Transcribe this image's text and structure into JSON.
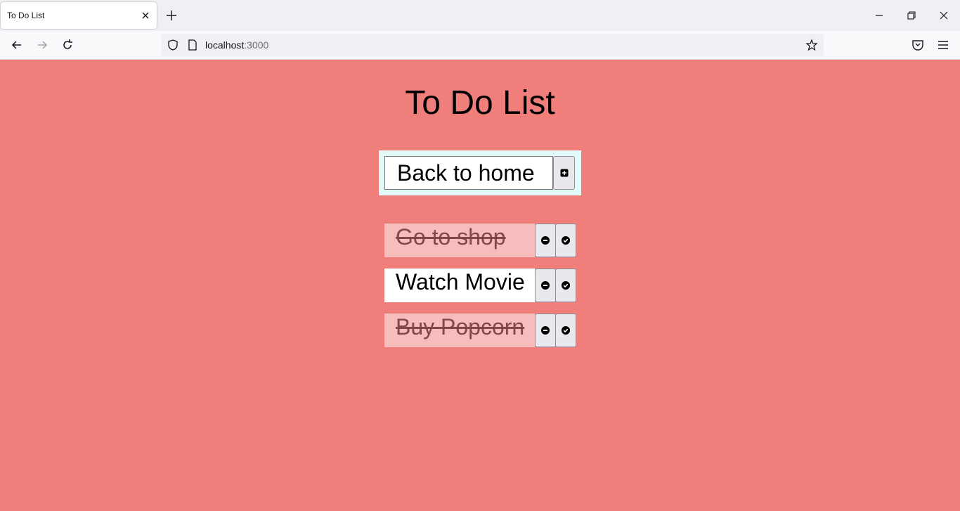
{
  "browser": {
    "tab_title": "To Do List",
    "url_host": "localhost",
    "url_port": ":3000"
  },
  "app": {
    "title": "To Do List",
    "input_value": "Back to home"
  },
  "items": [
    {
      "text": "Go to shop",
      "completed": true
    },
    {
      "text": "Watch Movie",
      "completed": false
    },
    {
      "text": "Buy Popcorn",
      "completed": true
    }
  ],
  "colors": {
    "page_background": "#f07e7b",
    "input_panel": "#e2faf9",
    "completed_item": "#f8bcbc",
    "completed_text": "#844747"
  }
}
